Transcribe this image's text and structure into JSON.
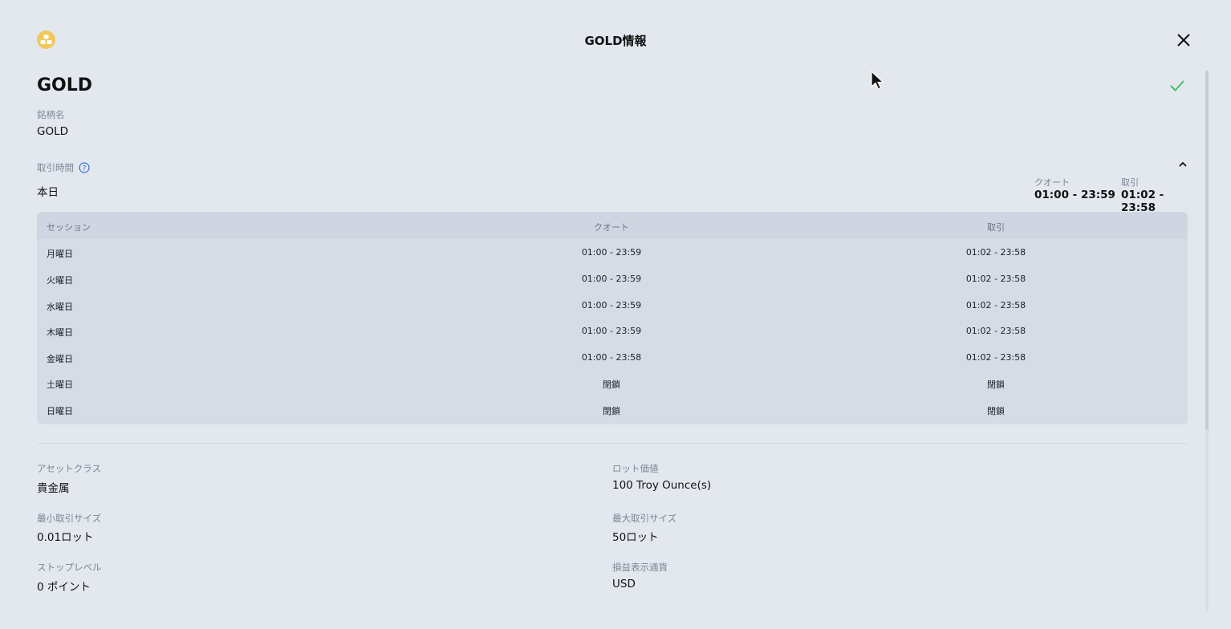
{
  "modal": {
    "title": "GOLD情報"
  },
  "symbol": {
    "title": "GOLD",
    "name_label": "銘柄名",
    "name_value": "GOLD"
  },
  "trading_hours": {
    "label": "取引時間",
    "today_label": "本日",
    "quote_label": "クオート",
    "quote_value": "01:00 - 23:59",
    "trade_label": "取引",
    "trade_value": "01:02 - 23:58"
  },
  "sessions_table": {
    "headers": [
      "セッション",
      "クオート",
      "取引"
    ],
    "rows": [
      {
        "day": "月曜日",
        "quote": "01:00 - 23:59",
        "trade": "01:02 - 23:58"
      },
      {
        "day": "火曜日",
        "quote": "01:00 - 23:59",
        "trade": "01:02 - 23:58"
      },
      {
        "day": "水曜日",
        "quote": "01:00 - 23:59",
        "trade": "01:02 - 23:58"
      },
      {
        "day": "木曜日",
        "quote": "01:00 - 23:59",
        "trade": "01:02 - 23:58"
      },
      {
        "day": "金曜日",
        "quote": "01:00 - 23:58",
        "trade": "01:02 - 23:58"
      },
      {
        "day": "土曜日",
        "quote": "閉鎖",
        "trade": "閉鎖"
      },
      {
        "day": "日曜日",
        "quote": "閉鎖",
        "trade": "閉鎖"
      }
    ]
  },
  "details": {
    "asset_class_label": "アセットクラス",
    "asset_class_value": "貴金属",
    "lot_value_label": "ロット価値",
    "lot_value_value": "100 Troy Ounce(s)",
    "min_size_label": "最小取引サイズ",
    "min_size_value": "0.01ロット",
    "max_size_label": "最大取引サイズ",
    "max_size_value": "50ロット",
    "stop_level_label": "ストップレベル",
    "stop_level_value": "0 ポイント",
    "pl_currency_label": "損益表示通貨",
    "pl_currency_value": "USD"
  },
  "colors": {
    "background": "#e3e8ef",
    "logo": "#f0c95a",
    "check": "#3fbf6a",
    "help": "#3b6fd6"
  }
}
